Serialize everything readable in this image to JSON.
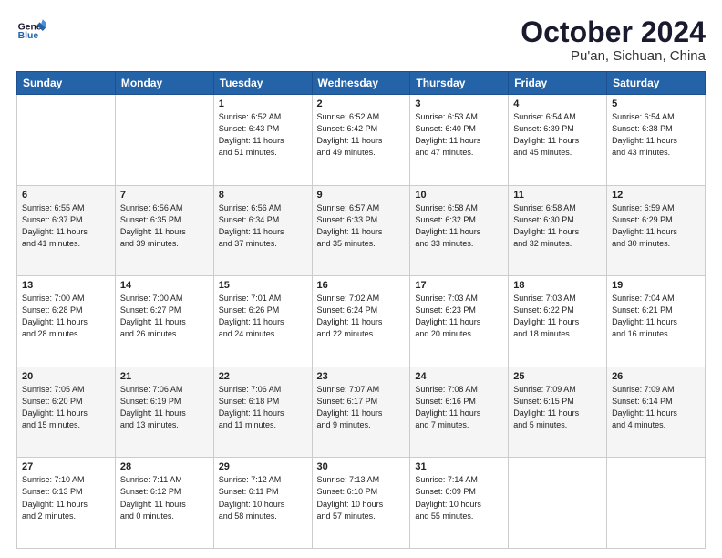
{
  "header": {
    "logo_line1": "General",
    "logo_line2": "Blue",
    "month_title": "October 2024",
    "location": "Pu'an, Sichuan, China"
  },
  "days_of_week": [
    "Sunday",
    "Monday",
    "Tuesday",
    "Wednesday",
    "Thursday",
    "Friday",
    "Saturday"
  ],
  "weeks": [
    [
      {
        "day": "",
        "info": ""
      },
      {
        "day": "",
        "info": ""
      },
      {
        "day": "1",
        "info": "Sunrise: 6:52 AM\nSunset: 6:43 PM\nDaylight: 11 hours\nand 51 minutes."
      },
      {
        "day": "2",
        "info": "Sunrise: 6:52 AM\nSunset: 6:42 PM\nDaylight: 11 hours\nand 49 minutes."
      },
      {
        "day": "3",
        "info": "Sunrise: 6:53 AM\nSunset: 6:40 PM\nDaylight: 11 hours\nand 47 minutes."
      },
      {
        "day": "4",
        "info": "Sunrise: 6:54 AM\nSunset: 6:39 PM\nDaylight: 11 hours\nand 45 minutes."
      },
      {
        "day": "5",
        "info": "Sunrise: 6:54 AM\nSunset: 6:38 PM\nDaylight: 11 hours\nand 43 minutes."
      }
    ],
    [
      {
        "day": "6",
        "info": "Sunrise: 6:55 AM\nSunset: 6:37 PM\nDaylight: 11 hours\nand 41 minutes."
      },
      {
        "day": "7",
        "info": "Sunrise: 6:56 AM\nSunset: 6:35 PM\nDaylight: 11 hours\nand 39 minutes."
      },
      {
        "day": "8",
        "info": "Sunrise: 6:56 AM\nSunset: 6:34 PM\nDaylight: 11 hours\nand 37 minutes."
      },
      {
        "day": "9",
        "info": "Sunrise: 6:57 AM\nSunset: 6:33 PM\nDaylight: 11 hours\nand 35 minutes."
      },
      {
        "day": "10",
        "info": "Sunrise: 6:58 AM\nSunset: 6:32 PM\nDaylight: 11 hours\nand 33 minutes."
      },
      {
        "day": "11",
        "info": "Sunrise: 6:58 AM\nSunset: 6:30 PM\nDaylight: 11 hours\nand 32 minutes."
      },
      {
        "day": "12",
        "info": "Sunrise: 6:59 AM\nSunset: 6:29 PM\nDaylight: 11 hours\nand 30 minutes."
      }
    ],
    [
      {
        "day": "13",
        "info": "Sunrise: 7:00 AM\nSunset: 6:28 PM\nDaylight: 11 hours\nand 28 minutes."
      },
      {
        "day": "14",
        "info": "Sunrise: 7:00 AM\nSunset: 6:27 PM\nDaylight: 11 hours\nand 26 minutes."
      },
      {
        "day": "15",
        "info": "Sunrise: 7:01 AM\nSunset: 6:26 PM\nDaylight: 11 hours\nand 24 minutes."
      },
      {
        "day": "16",
        "info": "Sunrise: 7:02 AM\nSunset: 6:24 PM\nDaylight: 11 hours\nand 22 minutes."
      },
      {
        "day": "17",
        "info": "Sunrise: 7:03 AM\nSunset: 6:23 PM\nDaylight: 11 hours\nand 20 minutes."
      },
      {
        "day": "18",
        "info": "Sunrise: 7:03 AM\nSunset: 6:22 PM\nDaylight: 11 hours\nand 18 minutes."
      },
      {
        "day": "19",
        "info": "Sunrise: 7:04 AM\nSunset: 6:21 PM\nDaylight: 11 hours\nand 16 minutes."
      }
    ],
    [
      {
        "day": "20",
        "info": "Sunrise: 7:05 AM\nSunset: 6:20 PM\nDaylight: 11 hours\nand 15 minutes."
      },
      {
        "day": "21",
        "info": "Sunrise: 7:06 AM\nSunset: 6:19 PM\nDaylight: 11 hours\nand 13 minutes."
      },
      {
        "day": "22",
        "info": "Sunrise: 7:06 AM\nSunset: 6:18 PM\nDaylight: 11 hours\nand 11 minutes."
      },
      {
        "day": "23",
        "info": "Sunrise: 7:07 AM\nSunset: 6:17 PM\nDaylight: 11 hours\nand 9 minutes."
      },
      {
        "day": "24",
        "info": "Sunrise: 7:08 AM\nSunset: 6:16 PM\nDaylight: 11 hours\nand 7 minutes."
      },
      {
        "day": "25",
        "info": "Sunrise: 7:09 AM\nSunset: 6:15 PM\nDaylight: 11 hours\nand 5 minutes."
      },
      {
        "day": "26",
        "info": "Sunrise: 7:09 AM\nSunset: 6:14 PM\nDaylight: 11 hours\nand 4 minutes."
      }
    ],
    [
      {
        "day": "27",
        "info": "Sunrise: 7:10 AM\nSunset: 6:13 PM\nDaylight: 11 hours\nand 2 minutes."
      },
      {
        "day": "28",
        "info": "Sunrise: 7:11 AM\nSunset: 6:12 PM\nDaylight: 11 hours\nand 0 minutes."
      },
      {
        "day": "29",
        "info": "Sunrise: 7:12 AM\nSunset: 6:11 PM\nDaylight: 10 hours\nand 58 minutes."
      },
      {
        "day": "30",
        "info": "Sunrise: 7:13 AM\nSunset: 6:10 PM\nDaylight: 10 hours\nand 57 minutes."
      },
      {
        "day": "31",
        "info": "Sunrise: 7:14 AM\nSunset: 6:09 PM\nDaylight: 10 hours\nand 55 minutes."
      },
      {
        "day": "",
        "info": ""
      },
      {
        "day": "",
        "info": ""
      }
    ]
  ]
}
